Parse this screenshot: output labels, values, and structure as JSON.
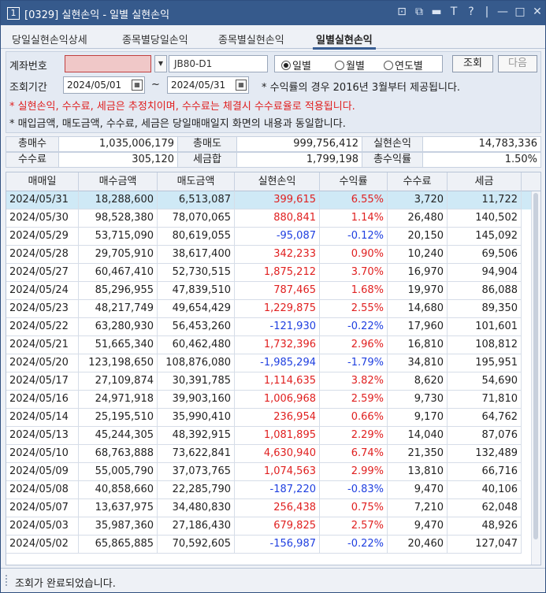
{
  "window": {
    "screen_no": "1",
    "title": "[0329] 실현손익 - 일별 실현손익",
    "buttons": [
      "⊡",
      "⧉",
      "▬",
      "T",
      "?",
      "|",
      "—",
      "□",
      "✕"
    ]
  },
  "tabs": [
    "당일실현손익상세",
    "종목별당일손익",
    "종목별실현손익",
    "일별실현손익"
  ],
  "active_tab": 3,
  "conditions": {
    "account_label": "계좌번호",
    "account_name": "JB80-D1",
    "radios": [
      "일별",
      "월별",
      "연도별"
    ],
    "selected_radio": 0,
    "search_button": "조회",
    "next_button": "다음",
    "period_label": "조회기간",
    "date_from": "2024/05/01",
    "date_sep": "~",
    "date_to": "2024/05/31",
    "note1": "* 수익률의 경우 2016년 3월부터 제공됩니다.",
    "note2": "* 실현손익, 수수료, 세금은 추정치이며, 수수료는 체결시 수수료율로 적용됩니다.",
    "note3": "* 매입금액, 매도금액, 수수료, 세금은 당일매매일지 화면의 내용과 동일합니다.",
    "note_color_red": "#e02020"
  },
  "summary": {
    "total_buy_label": "총매수",
    "total_buy": "1,035,006,179",
    "total_sell_label": "총매도",
    "total_sell": "999,756,412",
    "realized_label": "실현손익",
    "realized": "14,783,336",
    "fee_label": "수수료",
    "fee": "305,120",
    "tax_label": "세금합",
    "tax": "1,799,198",
    "return_label": "총수익률",
    "return": "1.50%"
  },
  "grid": {
    "columns": [
      "매매일",
      "매수금액",
      "매도금액",
      "실현손익",
      "수익률",
      "수수료",
      "세금"
    ],
    "rows": [
      [
        "2024/05/31",
        "18,288,600",
        "6,513,087",
        "399,615",
        "6.55%",
        "3,720",
        "11,722"
      ],
      [
        "2024/05/30",
        "98,528,380",
        "78,070,065",
        "880,841",
        "1.14%",
        "26,480",
        "140,502"
      ],
      [
        "2024/05/29",
        "53,715,090",
        "80,619,055",
        "-95,087",
        "-0.12%",
        "20,150",
        "145,092"
      ],
      [
        "2024/05/28",
        "29,705,910",
        "38,617,400",
        "342,233",
        "0.90%",
        "10,240",
        "69,506"
      ],
      [
        "2024/05/27",
        "60,467,410",
        "52,730,515",
        "1,875,212",
        "3.70%",
        "16,970",
        "94,904"
      ],
      [
        "2024/05/24",
        "85,296,955",
        "47,839,510",
        "787,465",
        "1.68%",
        "19,970",
        "86,088"
      ],
      [
        "2024/05/23",
        "48,217,749",
        "49,654,429",
        "1,229,875",
        "2.55%",
        "14,680",
        "89,350"
      ],
      [
        "2024/05/22",
        "63,280,930",
        "56,453,260",
        "-121,930",
        "-0.22%",
        "17,960",
        "101,601"
      ],
      [
        "2024/05/21",
        "51,665,340",
        "60,462,480",
        "1,732,396",
        "2.96%",
        "16,810",
        "108,812"
      ],
      [
        "2024/05/20",
        "123,198,650",
        "108,876,080",
        "-1,985,294",
        "-1.79%",
        "34,810",
        "195,951"
      ],
      [
        "2024/05/17",
        "27,109,874",
        "30,391,785",
        "1,114,635",
        "3.82%",
        "8,620",
        "54,690"
      ],
      [
        "2024/05/16",
        "24,971,918",
        "39,903,160",
        "1,006,968",
        "2.59%",
        "9,730",
        "71,810"
      ],
      [
        "2024/05/14",
        "25,195,510",
        "35,990,410",
        "236,954",
        "0.66%",
        "9,170",
        "64,762"
      ],
      [
        "2024/05/13",
        "45,244,305",
        "48,392,915",
        "1,081,895",
        "2.29%",
        "14,040",
        "87,076"
      ],
      [
        "2024/05/10",
        "68,763,888",
        "73,622,841",
        "4,630,940",
        "6.74%",
        "21,350",
        "132,489"
      ],
      [
        "2024/05/09",
        "55,005,790",
        "37,073,765",
        "1,074,563",
        "2.99%",
        "13,810",
        "66,716"
      ],
      [
        "2024/05/08",
        "40,858,660",
        "22,285,790",
        "-187,220",
        "-0.83%",
        "9,470",
        "40,106"
      ],
      [
        "2024/05/07",
        "13,637,975",
        "34,480,830",
        "256,438",
        "0.75%",
        "7,210",
        "62,048"
      ],
      [
        "2024/05/03",
        "35,987,360",
        "27,186,430",
        "679,825",
        "2.57%",
        "9,470",
        "48,926"
      ],
      [
        "2024/05/02",
        "65,865,885",
        "70,592,605",
        "-156,987",
        "-0.22%",
        "20,460",
        "127,047"
      ]
    ],
    "selected_row": 0,
    "pos_color": "#e02020",
    "neg_color": "#2040e0"
  },
  "status": {
    "message": "조회가 완료되었습니다."
  }
}
